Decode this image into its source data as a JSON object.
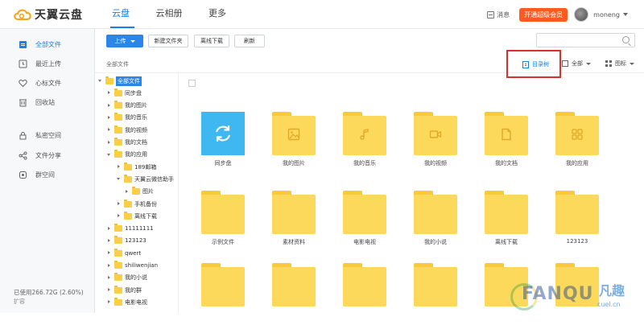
{
  "header": {
    "logo_text": "天翼云盘",
    "nav": [
      "云盘",
      "云相册",
      "更多"
    ],
    "messages_label": "消息",
    "vip_label": "开通超级会员",
    "username": "moneng"
  },
  "sidebar": {
    "items": [
      {
        "label": "全部文件",
        "icon": "files-icon"
      },
      {
        "label": "最近上传",
        "icon": "clock-icon"
      },
      {
        "label": "心标文件",
        "icon": "heart-icon"
      },
      {
        "label": "回收站",
        "icon": "trash-icon"
      },
      {
        "label": "私密空间",
        "icon": "lock-icon"
      },
      {
        "label": "文件分享",
        "icon": "share-icon"
      },
      {
        "label": "群空间",
        "icon": "group-icon"
      }
    ],
    "storage": "已使用266.72G (2.60%)",
    "expand": "扩容"
  },
  "toolbar": {
    "upload": "上传",
    "new_folder": "新建文件夹",
    "offline": "离线下载",
    "refresh": "刷新",
    "search_placeholder": ""
  },
  "crumbbar": {
    "crumb": "全部文件",
    "tree_toggle": "目录树",
    "sort": "全部",
    "view": "图标"
  },
  "tree": [
    {
      "label": "全部文件",
      "level": 0,
      "toggle": "down",
      "selected": true
    },
    {
      "label": "同步盘",
      "level": 1,
      "toggle": "right"
    },
    {
      "label": "我的图片",
      "level": 1,
      "toggle": "right"
    },
    {
      "label": "我的音乐",
      "level": 1,
      "toggle": "right"
    },
    {
      "label": "我的视频",
      "level": 1,
      "toggle": "right"
    },
    {
      "label": "我的文档",
      "level": 1,
      "toggle": "right"
    },
    {
      "label": "我的应用",
      "level": 1,
      "toggle": "down"
    },
    {
      "label": "189邮箱",
      "level": 2,
      "toggle": "right"
    },
    {
      "label": "天翼云微信助手",
      "level": 2,
      "toggle": "down"
    },
    {
      "label": "图片",
      "level": 3,
      "toggle": "right"
    },
    {
      "label": "手机备份",
      "level": 2,
      "toggle": "right"
    },
    {
      "label": "离线下载",
      "level": 2,
      "toggle": "right"
    },
    {
      "label": "11111111",
      "level": 1,
      "toggle": "right"
    },
    {
      "label": "123123",
      "level": 1,
      "toggle": "right"
    },
    {
      "label": "qwert",
      "level": 1,
      "toggle": "right"
    },
    {
      "label": "shiliwenjian",
      "level": 1,
      "toggle": "right"
    },
    {
      "label": "我的小说",
      "level": 1,
      "toggle": "right"
    },
    {
      "label": "我的群",
      "level": 1,
      "toggle": "right"
    },
    {
      "label": "电影电视",
      "level": 1,
      "toggle": "right"
    }
  ],
  "files": {
    "row1": [
      {
        "name": "同步盘",
        "kind": "sync"
      },
      {
        "name": "我的图片",
        "kind": "image"
      },
      {
        "name": "我的音乐",
        "kind": "music"
      },
      {
        "name": "我的视频",
        "kind": "video"
      },
      {
        "name": "我的文档",
        "kind": "doc"
      },
      {
        "name": "我的应用",
        "kind": "app"
      }
    ],
    "row2": [
      {
        "name": "示例文件",
        "kind": "plain"
      },
      {
        "name": "素材资料",
        "kind": "plain"
      },
      {
        "name": "电影电视",
        "kind": "plain"
      },
      {
        "name": "我的小说",
        "kind": "plain"
      },
      {
        "name": "离线下载",
        "kind": "plain"
      },
      {
        "name": "123123",
        "kind": "plain"
      }
    ],
    "row3": [
      {
        "name": "",
        "kind": "plain"
      },
      {
        "name": "",
        "kind": "plain"
      },
      {
        "name": "",
        "kind": "plain"
      },
      {
        "name": "",
        "kind": "plain"
      },
      {
        "name": "",
        "kind": "plain"
      },
      {
        "name": "",
        "kind": "plain"
      }
    ]
  },
  "watermark": {
    "text": "FANQU",
    "cn": "凡趣",
    "url": "cuel.cn"
  },
  "colors": {
    "accent": "#1a7fe6",
    "vip": "#ff5a1f",
    "folder": "#fcd95b",
    "sync_tile": "#3fb7f0",
    "highlight_box": "#d9302c"
  }
}
